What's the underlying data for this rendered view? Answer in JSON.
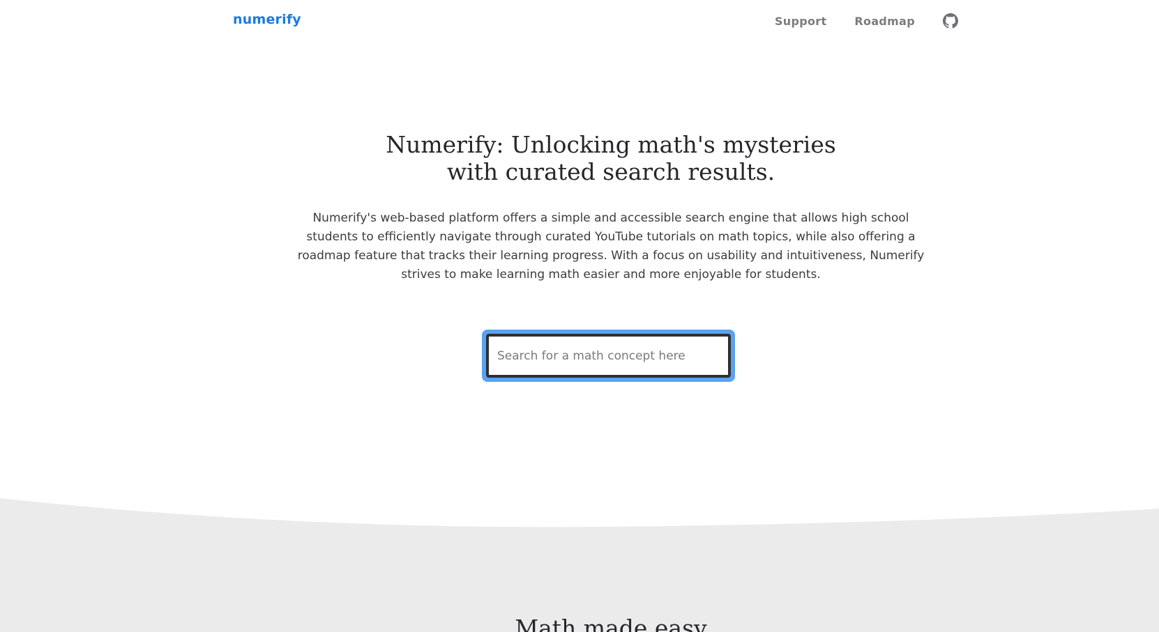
{
  "header": {
    "brand": "numerify",
    "nav": {
      "support_label": "Support",
      "roadmap_label": "Roadmap",
      "github_icon": "github-icon"
    }
  },
  "hero": {
    "title": "Numerify: Unlocking math's mysteries with curated search results.",
    "description": "Numerify's web-based platform offers a simple and accessible search engine that allows high school students to efficiently navigate through curated YouTube tutorials on math topics, while also offering a roadmap feature that tracks their learning progress. With a focus on usability and intuitiveness, Numerify strives to make learning math easier and more enjoyable for students."
  },
  "search": {
    "placeholder": "Search for a math concept here",
    "value": ""
  },
  "section": {
    "title": "Math made easy"
  },
  "colors": {
    "brand": "#1a7be0",
    "focus_ring": "#5aa2f0",
    "section_background": "#ebebeb"
  }
}
